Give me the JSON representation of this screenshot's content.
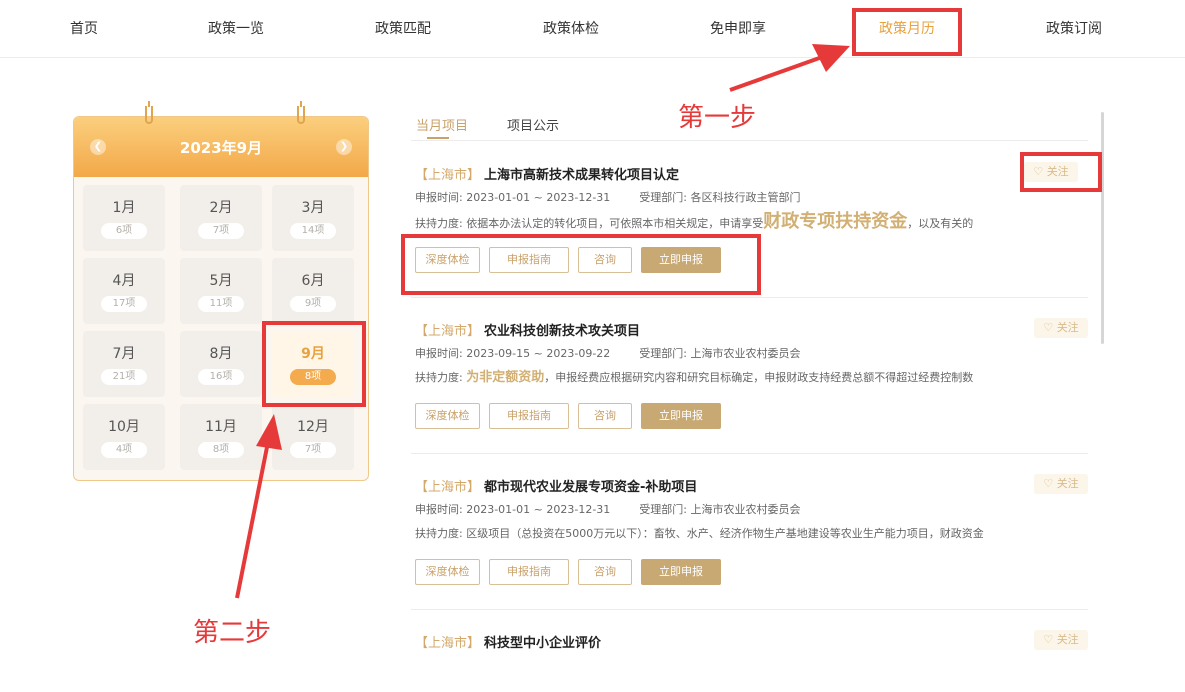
{
  "nav": {
    "items": [
      "首页",
      "政策一览",
      "政策匹配",
      "政策体检",
      "免申即享",
      "政策月历",
      "政策订阅"
    ],
    "active_index": 5
  },
  "calendar": {
    "title": "2023年9月",
    "prev_icon": "chevron-left-icon",
    "next_icon": "chevron-right-icon",
    "active_month": "9月",
    "months": [
      {
        "name": "1月",
        "count": "6项"
      },
      {
        "name": "2月",
        "count": "7项"
      },
      {
        "name": "3月",
        "count": "14项"
      },
      {
        "name": "4月",
        "count": "17项"
      },
      {
        "name": "5月",
        "count": "11项"
      },
      {
        "name": "6月",
        "count": "9项"
      },
      {
        "name": "7月",
        "count": "21项"
      },
      {
        "name": "8月",
        "count": "16项"
      },
      {
        "name": "9月",
        "count": "8项"
      },
      {
        "name": "10月",
        "count": "4项"
      },
      {
        "name": "11月",
        "count": "8项"
      },
      {
        "name": "12月",
        "count": "7项"
      }
    ]
  },
  "tabs": [
    "当月项目",
    "项目公示"
  ],
  "active_tab": "当月项目",
  "follow_label": "关注",
  "follow_icon": "heart-icon",
  "actions": {
    "deep_check": "深度体检",
    "guide": "申报指南",
    "consult": "咨询",
    "apply": "立即申报"
  },
  "labels": {
    "apply_time": "申报时间:",
    "dept": "受理部门:",
    "support": "扶持力度:"
  },
  "projects": [
    {
      "region": "【上海市】",
      "name": "上海市高新技术成果转化项目认定",
      "time": "2023-01-01 ~ 2023-12-31",
      "dept": "各区科技行政主管部门",
      "support_pre": "依据本办法认定的转化项目，可依照本市相关规定，申请享受",
      "support_highlight": "财政专项扶持资金",
      "support_post": "，以及有关的"
    },
    {
      "region": "【上海市】",
      "name": "农业科技创新技术攻关项目",
      "time": "2023-09-15 ~ 2023-09-22",
      "dept": "上海市农业农村委员会",
      "support_pre": "",
      "support_highlight": "为非定额资助",
      "support_post": "，申报经费应根据研究内容和研究目标确定，申报财政支持经费总额不得超过经费控制数"
    },
    {
      "region": "【上海市】",
      "name": "都市现代农业发展专项资金-补助项目",
      "time": "2023-01-01 ~ 2023-12-31",
      "dept": "上海市农业农村委员会",
      "support_pre": "区级项目（总投资在5000万元以下）：畜牧、水产、经济作物生产基地建设等农业生产能力项目，财政资金",
      "support_highlight": "",
      "support_post": ""
    },
    {
      "region": "【上海市】",
      "name": "科技型中小企业评价"
    }
  ],
  "annotations": {
    "step1": "第一步",
    "step2": "第二步"
  },
  "colors": {
    "gold": "#c9a16a",
    "orange": "#f3ab4d",
    "red": "#e63a3a"
  }
}
